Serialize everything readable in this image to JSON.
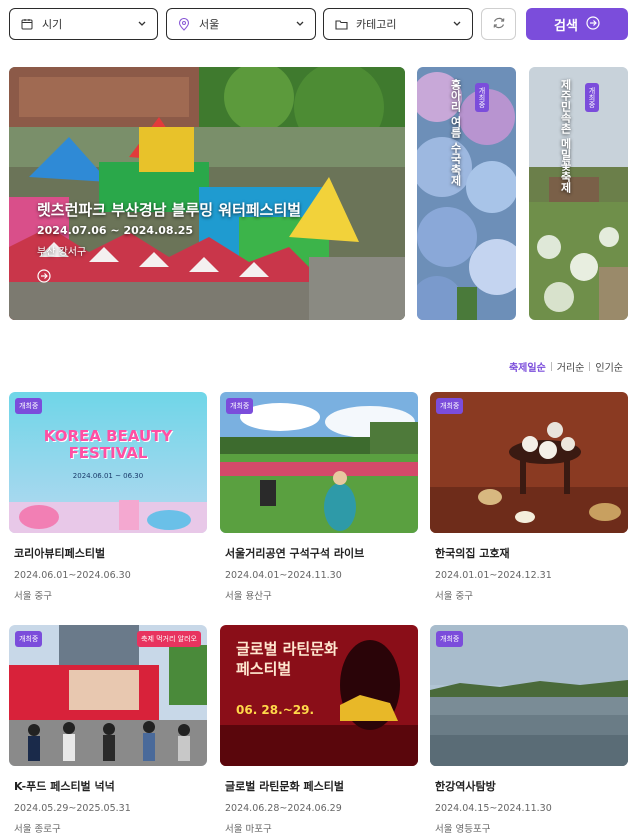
{
  "filters": {
    "date_label": "시기",
    "region_label": "서울",
    "category_label": "카테고리"
  },
  "search_label": "검색",
  "hero": {
    "main": {
      "title": "렛츠런파크 부산경남 블루밍 워터페스티벌",
      "date": "2024.07.06 ~ 2024.08.25",
      "location": "부산 강서구"
    },
    "side": [
      {
        "title": "홍아리 여름 수국축제",
        "badge": "개최중"
      },
      {
        "title": "제주민속촌 메밀꽃축제",
        "badge": "개최중"
      }
    ]
  },
  "sort": {
    "options": [
      "축제일순",
      "거리순",
      "인기순"
    ],
    "active": "축제일순"
  },
  "cards": [
    {
      "title": "코리아뷰티페스티벌",
      "date": "2024.06.01~2024.06.30",
      "location": "서울 중구",
      "badge": "개최중",
      "poster_text": "KOREA BEAUTY FESTIVAL",
      "poster_date": "2024.06.01 ~ 06.30"
    },
    {
      "title": "서울거리공연 구석구석 라이브",
      "date": "2024.04.01~2024.11.30",
      "location": "서울 용산구",
      "badge": "개최중"
    },
    {
      "title": "한국의집 고호재",
      "date": "2024.01.01~2024.12.31",
      "location": "서울 중구",
      "badge": "개최중"
    },
    {
      "title": "K-푸드 페스티벌 넉넉",
      "date": "2024.05.29~2025.05.31",
      "location": "서울 종로구",
      "badge": "개최중",
      "badge2": "축제 먹거리 알러오"
    },
    {
      "title": "글로벌 라틴문화 페스티벌",
      "date": "2024.06.28~2024.06.29",
      "location": "서울 마포구",
      "badge": "",
      "poster_text": "글로벌 라틴문화 페스티벌",
      "poster_date": "06. 28.~29."
    },
    {
      "title": "한강역사탐방",
      "date": "2024.04.15~2024.11.30",
      "location": "서울 영등포구",
      "badge": "개최중"
    }
  ]
}
